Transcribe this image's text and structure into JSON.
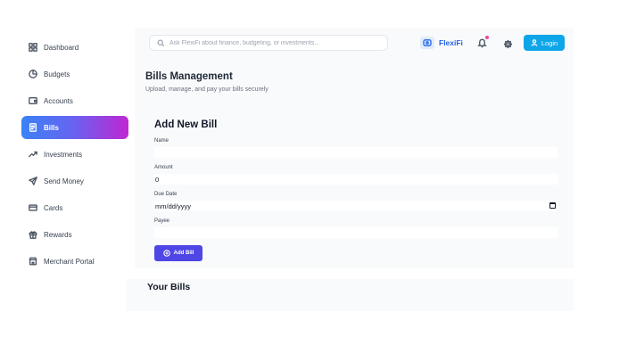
{
  "sidebar": {
    "items": [
      {
        "label": "Dashboard",
        "icon": "dashboard-grid-icon",
        "active": false
      },
      {
        "label": "Budgets",
        "icon": "pie-chart-icon",
        "active": false
      },
      {
        "label": "Accounts",
        "icon": "wallet-icon",
        "active": false
      },
      {
        "label": "Bills",
        "icon": "receipt-icon",
        "active": true
      },
      {
        "label": "Investments",
        "icon": "trending-up-icon",
        "active": false
      },
      {
        "label": "Send Money",
        "icon": "send-icon",
        "active": false
      },
      {
        "label": "Cards",
        "icon": "credit-card-icon",
        "active": false
      },
      {
        "label": "Rewards",
        "icon": "gift-icon",
        "active": false
      },
      {
        "label": "Merchant Portal",
        "icon": "store-icon",
        "active": false
      }
    ]
  },
  "header": {
    "search_placeholder": "Ask FlexiFi about finance, budgeting, or investments...",
    "brand_name": "FlexiFi",
    "login_label": "Login"
  },
  "page": {
    "title": "Bills Management",
    "subtitle": "Upload, manage, and pay your bills securely"
  },
  "form": {
    "title": "Add New Bill",
    "name_label": "Name",
    "name_value": "",
    "amount_label": "Amount",
    "amount_value": "0",
    "due_date_label": "Due Date",
    "due_date_value": "mm/dd/yyyy",
    "payee_label": "Payee",
    "payee_value": "",
    "submit_label": "Add Bill"
  },
  "bills": {
    "title": "Your Bills"
  },
  "colors": {
    "accent": "#0ea5e9",
    "brand": "#2563eb",
    "primary_button": "#4f46e5",
    "active_gradient_start": "#3b82f6",
    "active_gradient_end": "#c026d3",
    "notification_dot": "#ec4899"
  }
}
